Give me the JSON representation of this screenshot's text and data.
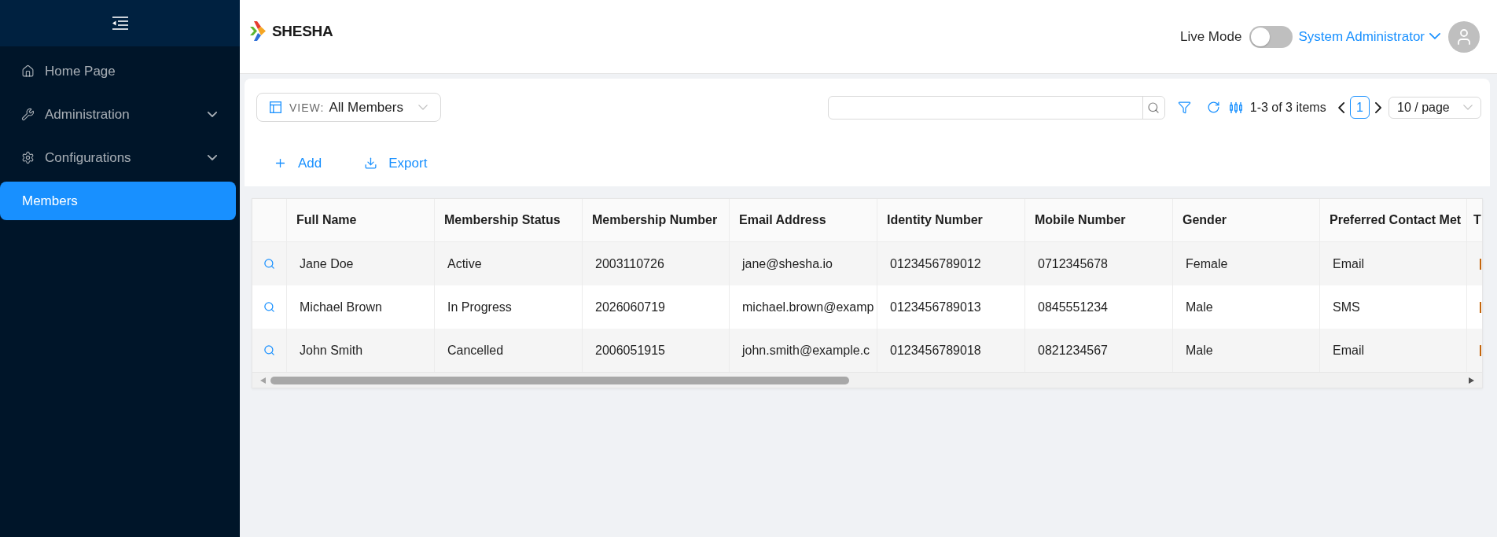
{
  "sidebar": {
    "items": [
      {
        "label": "Home Page",
        "selected": false,
        "expandable": false
      },
      {
        "label": "Administration",
        "selected": false,
        "expandable": true
      },
      {
        "label": "Configurations",
        "selected": false,
        "expandable": true
      },
      {
        "label": "Members",
        "selected": true,
        "expandable": false
      }
    ]
  },
  "header": {
    "logo_text": "SHESHA",
    "live_mode": {
      "label": "Live Mode",
      "on": false
    },
    "user": {
      "name": "System Administrator"
    }
  },
  "toolbar": {
    "view": {
      "prefix": "VIEW:",
      "value": "All Members"
    },
    "actions": [
      {
        "label": "Add"
      },
      {
        "label": "Export"
      }
    ],
    "pagination": {
      "summary": "1-3 of 3 items",
      "pages": [
        {
          "label": "1",
          "selected": true
        }
      ],
      "page_size": "10 / page"
    }
  },
  "table": {
    "columns": [
      "Full Name",
      "Membership Status",
      "Membership Number",
      "Email Address",
      "Identity Number",
      "Mobile Number",
      "Gender",
      "Preferred Contact Met",
      "T"
    ],
    "rows": [
      {
        "cells": [
          "Jane Doe",
          "Active",
          "2003110726",
          "jane@shesha.io",
          "0123456789012",
          "0712345678",
          "Female",
          "Email"
        ],
        "column_10_tag": true
      },
      {
        "cells": [
          "Michael Brown",
          "In Progress",
          "2026060719",
          "michael.brown@examp",
          "0123456789013",
          "0845551234",
          "Male",
          "SMS"
        ],
        "column_10_tag": true
      },
      {
        "cells": [
          "John Smith",
          "Cancelled",
          "2006051915",
          "john.smith@example.c",
          "0123456789018",
          "0821234567",
          "Male",
          "Email"
        ],
        "column_10_tag": true
      }
    ]
  }
}
